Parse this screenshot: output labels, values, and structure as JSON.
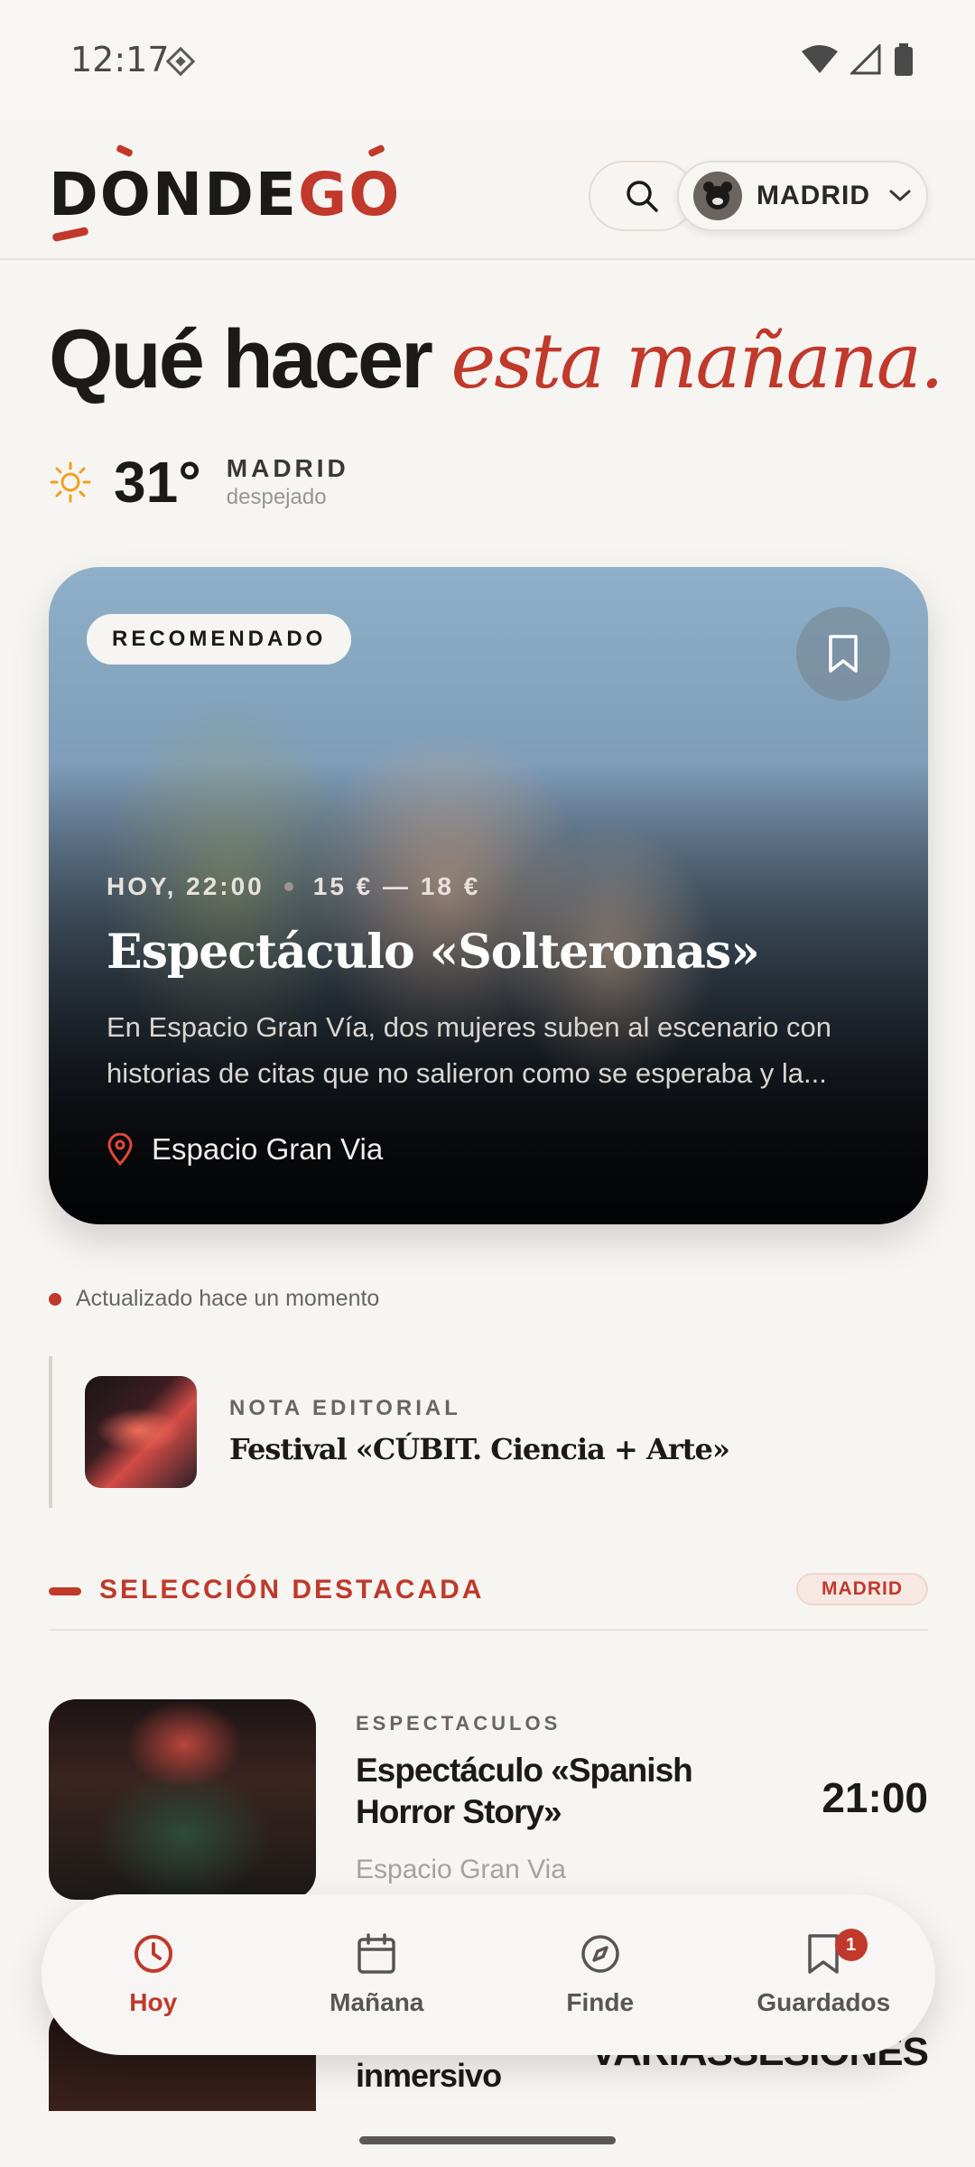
{
  "status_bar": {
    "time": "12:17"
  },
  "header": {
    "logo": {
      "part1": "D",
      "part2": "ONDE",
      "part3": "G",
      "part4": "O"
    },
    "city_label": "MADRID"
  },
  "headline": {
    "plain": "Qué hacer",
    "accent": "esta mañana",
    "dot": "."
  },
  "weather": {
    "temp": "31°",
    "city": "MADRID",
    "condition": "despejado"
  },
  "hero": {
    "badge": "RECOMENDADO",
    "date": "HOY, 22:00",
    "price": "15 € — 18 €",
    "title": "Espectáculo «Solteronas»",
    "description": "En Espacio Gran Vía, dos mujeres suben al escenario con historias de citas que no salieron como se esperaba y la...",
    "venue": "Espacio Gran Via"
  },
  "updated_text": "Actualizado hace un momento",
  "note": {
    "kicker": "NOTA EDITORIAL",
    "title": "Festival «CÚBIT. Ciencia + Arte»"
  },
  "section": {
    "title": "SELECCIÓN DESTACADA",
    "chip": "MADRID"
  },
  "events": [
    {
      "category": "ESPECTACULOS",
      "title": "Espectáculo «Spanish Horror Story»",
      "venue": "Espacio Gran Via",
      "time": "21:00"
    },
    {
      "title": "Espectáculo inmersivo",
      "time": "VARIASSESIONES"
    }
  ],
  "nav": [
    {
      "label": "Hoy",
      "icon": "clock-icon",
      "active": true
    },
    {
      "label": "Mañana",
      "icon": "calendar-icon"
    },
    {
      "label": "Finde",
      "icon": "compass-icon"
    },
    {
      "label": "Guardados",
      "icon": "bookmark-icon",
      "badge": "1"
    }
  ],
  "colors": {
    "accent": "#c0392b",
    "background": "#f7f5f2",
    "text": "#1c1a19"
  }
}
